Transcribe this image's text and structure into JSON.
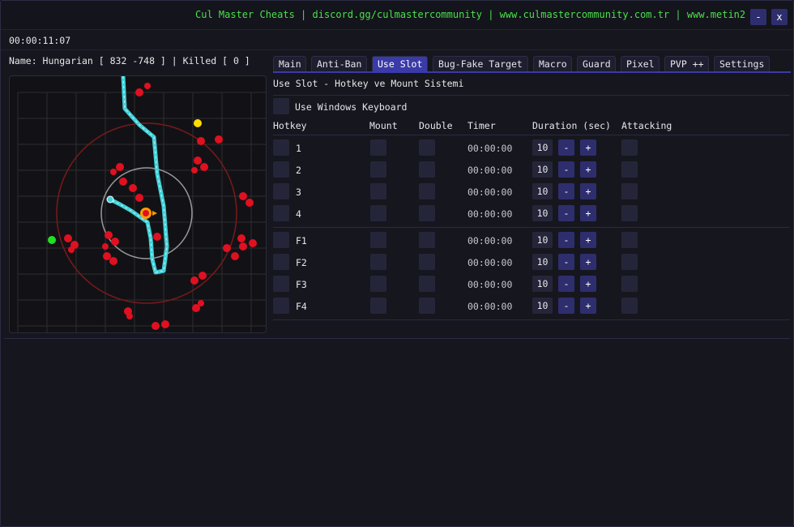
{
  "titlebar": {
    "text": "Cul Master Cheats | discord.gg/culmastercommunity | www.culmastercommunity.com.tr | www.metin2",
    "minimize_label": "-",
    "close_label": "x"
  },
  "session_timer": "00:00:11:07",
  "status": "Name: Hungarian [ 832 -748 ] | Killed [ 0 ]",
  "tabs": [
    {
      "label": "Main",
      "active": false
    },
    {
      "label": "Anti-Ban",
      "active": false
    },
    {
      "label": "Use Slot",
      "active": true
    },
    {
      "label": "Bug-Fake Target",
      "active": false
    },
    {
      "label": "Macro",
      "active": false
    },
    {
      "label": "Guard",
      "active": false
    },
    {
      "label": "Pixel",
      "active": false
    },
    {
      "label": "PVP ++",
      "active": false
    },
    {
      "label": "Settings",
      "active": false
    }
  ],
  "use_slot": {
    "title": "Use Slot - Hotkey ve Mount Sistemi",
    "use_windows_keyboard_label": "Use Windows Keyboard",
    "headers": {
      "hotkey": "Hotkey",
      "mount": "Mount",
      "double": "Double",
      "timer": "Timer",
      "duration": "Duration (sec)",
      "attacking": "Attacking"
    },
    "minus_label": "-",
    "plus_label": "+",
    "rows": [
      {
        "key": "1",
        "timer": "00:00:00",
        "duration": "10"
      },
      {
        "key": "2",
        "timer": "00:00:00",
        "duration": "10"
      },
      {
        "key": "3",
        "timer": "00:00:00",
        "duration": "10"
      },
      {
        "key": "4",
        "timer": "00:00:00",
        "duration": "10"
      },
      {
        "key": "F1",
        "timer": "00:00:00",
        "duration": "10"
      },
      {
        "key": "F2",
        "timer": "00:00:00",
        "duration": "10"
      },
      {
        "key": "F3",
        "timer": "00:00:00",
        "duration": "10"
      },
      {
        "key": "F4",
        "timer": "00:00:00",
        "duration": "10"
      }
    ]
  },
  "colors": {
    "accent": "#3a3aa8",
    "title_text": "#4ae04a",
    "panel": "#16161e",
    "monster": "#e01020",
    "path": "#40d0d8"
  },
  "radar": {
    "icons": [
      "player-icon",
      "monster-icon",
      "npc-icon",
      "waypoint-icon"
    ]
  }
}
